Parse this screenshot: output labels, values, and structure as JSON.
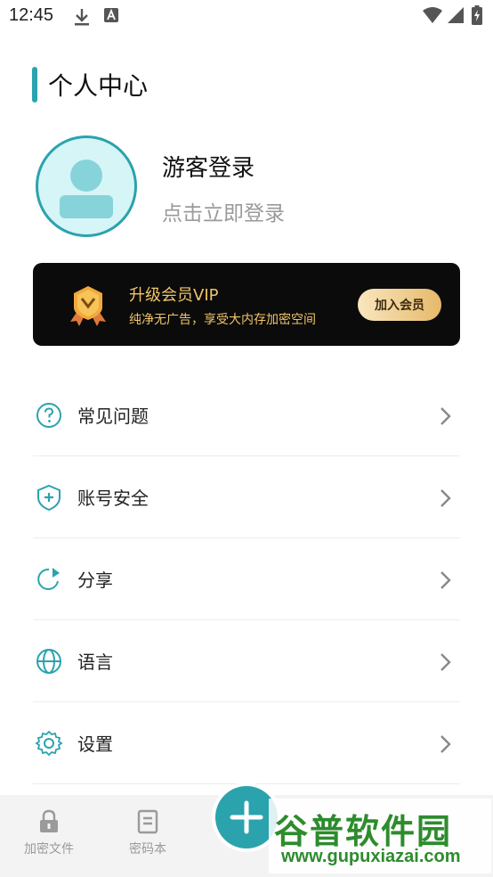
{
  "status_bar": {
    "time": "12:45",
    "icons": [
      "download-icon",
      "a-badge-icon",
      "wifi-icon",
      "signal-icon",
      "battery-icon"
    ]
  },
  "header": {
    "title": "个人中心"
  },
  "profile": {
    "title": "游客登录",
    "subtitle": "点击立即登录"
  },
  "vip": {
    "title": "升级会员VIP",
    "description": "纯净无广告，享受大内存加密空间",
    "button_label": "加入会员"
  },
  "menu": {
    "items": [
      {
        "label": "常见问题",
        "icon": "question-icon"
      },
      {
        "label": "账号安全",
        "icon": "shield-plus-icon"
      },
      {
        "label": "分享",
        "icon": "share-icon"
      },
      {
        "label": "语言",
        "icon": "globe-icon"
      },
      {
        "label": "设置",
        "icon": "gear-icon"
      }
    ]
  },
  "bottom_nav": {
    "items": [
      {
        "label": "加密文件",
        "icon": "lock-icon"
      },
      {
        "label": "密码本",
        "icon": "notebook-icon"
      }
    ],
    "fab_icon": "plus-icon"
  },
  "watermark": {
    "title": "谷普软件园",
    "url": "www.gupuxiazai.com"
  },
  "colors": {
    "accent": "#2aa3ad",
    "vip_gold": "#f0c469",
    "vip_background": "#0b0b0b"
  }
}
